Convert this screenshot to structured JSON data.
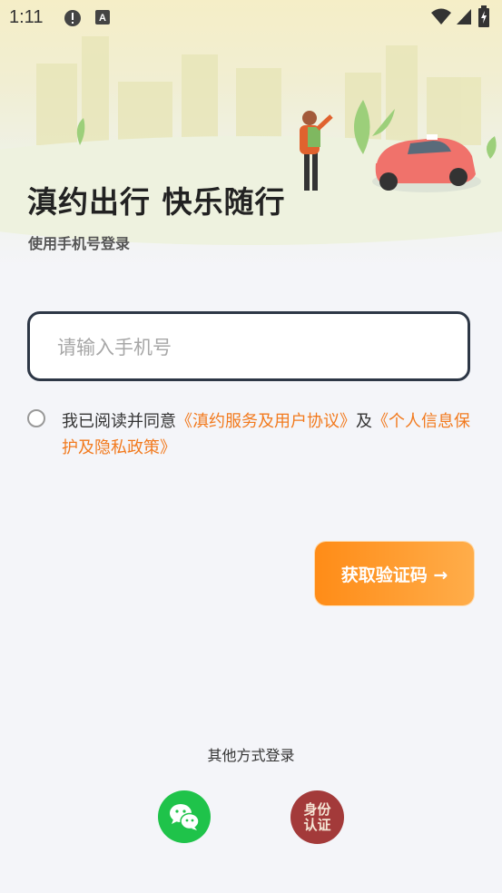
{
  "status_bar": {
    "time": "1:11"
  },
  "header": {
    "title": "滇约出行 快乐随行",
    "subtitle": "使用手机号登录"
  },
  "phone_input": {
    "placeholder": "请输入手机号",
    "value": ""
  },
  "agreement": {
    "prefix": "我已阅读并同意",
    "service_link": "《滇约服务及用户协议》",
    "conjunction": "及",
    "privacy_link": "《个人信息保护及隐私政策》",
    "checked": false
  },
  "get_code_button": {
    "label": "获取验证码 →"
  },
  "other_login": {
    "label": "其他方式登录",
    "wechat_icon": "wechat-icon",
    "id_auth_line1": "身份",
    "id_auth_line2": "认证"
  },
  "colors": {
    "accent": "#f27a1e",
    "wechat": "#1fc34a",
    "id_auth": "#a33a3a"
  }
}
